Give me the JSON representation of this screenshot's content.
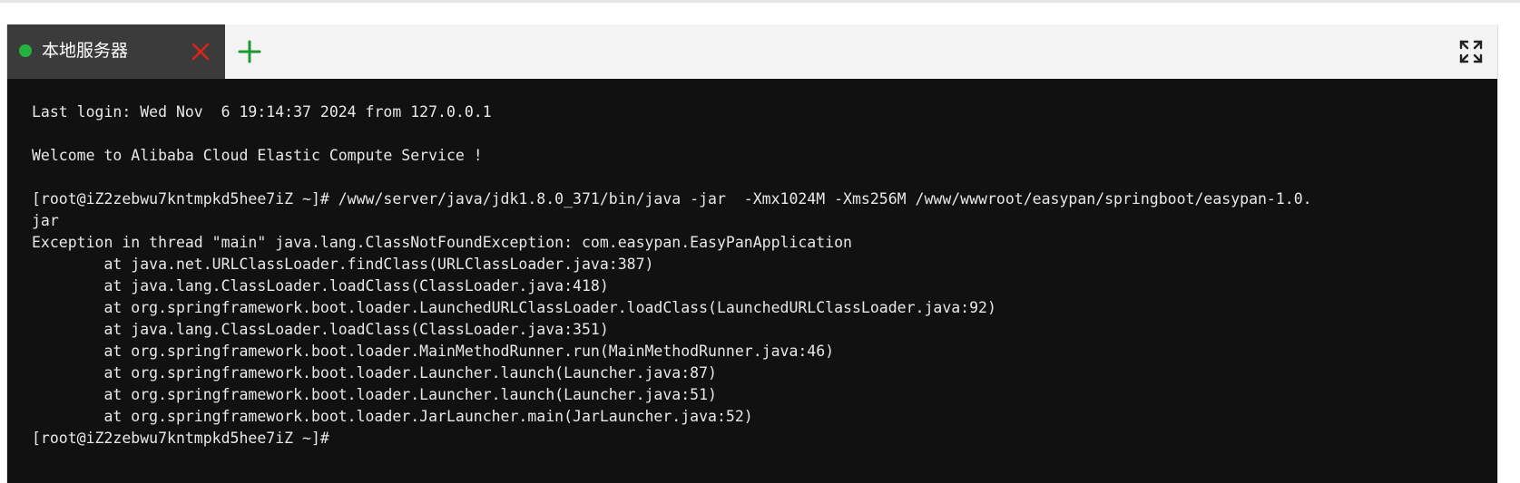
{
  "tabs": {
    "active": {
      "label": "本地服务器",
      "status_color": "#26b33d",
      "status": "connected"
    },
    "close_icon": "close-icon",
    "add_icon": "plus-icon",
    "fullscreen_icon": "fullscreen-icon"
  },
  "colors": {
    "tab_active_bg": "#3b3b3b",
    "close": "#d9261c",
    "add": "#1d9a2f",
    "terminal_bg": "#111111",
    "terminal_fg": "#e8e8e8"
  },
  "terminal": {
    "lines": [
      "Last login: Wed Nov  6 19:14:37 2024 from 127.0.0.1",
      "",
      "Welcome to Alibaba Cloud Elastic Compute Service !",
      "",
      "[root@iZ2zebwu7kntmpkd5hee7iZ ~]# /www/server/java/jdk1.8.0_371/bin/java -jar  -Xmx1024M -Xms256M /www/wwwroot/easypan/springboot/easypan-1.0.",
      "jar",
      "Exception in thread \"main\" java.lang.ClassNotFoundException: com.easypan.EasyPanApplication",
      "        at java.net.URLClassLoader.findClass(URLClassLoader.java:387)",
      "        at java.lang.ClassLoader.loadClass(ClassLoader.java:418)",
      "        at org.springframework.boot.loader.LaunchedURLClassLoader.loadClass(LaunchedURLClassLoader.java:92)",
      "        at java.lang.ClassLoader.loadClass(ClassLoader.java:351)",
      "        at org.springframework.boot.loader.MainMethodRunner.run(MainMethodRunner.java:46)",
      "        at org.springframework.boot.loader.Launcher.launch(Launcher.java:87)",
      "        at org.springframework.boot.loader.Launcher.launch(Launcher.java:51)",
      "        at org.springframework.boot.loader.JarLauncher.main(JarLauncher.java:52)",
      "[root@iZ2zebwu7kntmpkd5hee7iZ ~]#"
    ]
  }
}
